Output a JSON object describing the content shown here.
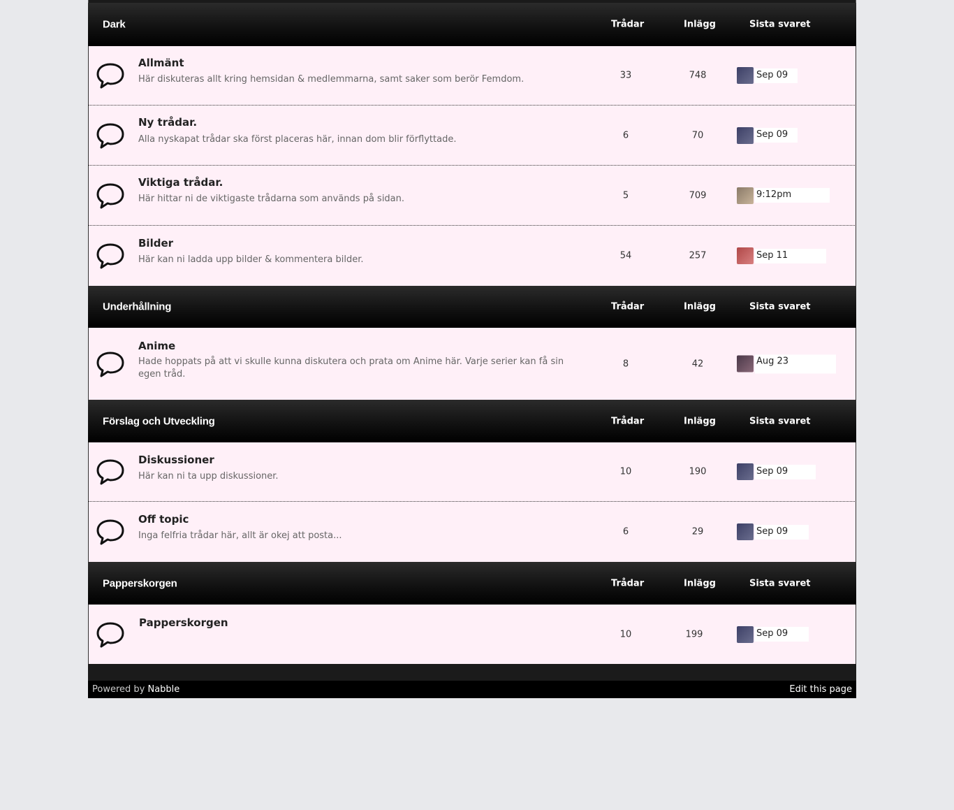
{
  "columns": {
    "threads": "Trådar",
    "posts": "Inlägg",
    "last": "Sista svaret"
  },
  "categories": [
    {
      "title": "Dark",
      "forums": [
        {
          "name": "Allmänt",
          "desc": "Här diskuteras allt kring hemsidan & medlemmarna, samt saker som berör Femdom.",
          "threads": "33",
          "posts": "748",
          "last": "Sep 09"
        },
        {
          "name": "Ny trådar.",
          "desc": "Alla nyskapat trådar ska först placeras här, innan dom blir förflyttade.",
          "threads": "6",
          "posts": "70",
          "last": "Sep 09"
        },
        {
          "name": "Viktiga trådar.",
          "desc": "Här hittar ni de viktigaste trådarna som används på sidan.",
          "threads": "5",
          "posts": "709",
          "last": "9:12pm"
        },
        {
          "name": "Bilder",
          "desc": "Här kan ni ladda upp bilder & kommentera bilder.",
          "threads": "54",
          "posts": "257",
          "last": "Sep 11"
        }
      ]
    },
    {
      "title": "Underhållning",
      "forums": [
        {
          "name": "Anime",
          "desc": "Hade hoppats på att vi skulle kunna diskutera och prata om Anime här. Varje serier kan få sin egen tråd.",
          "threads": "8",
          "posts": "42",
          "last": "Aug 23"
        }
      ]
    },
    {
      "title": "Förslag och Utveckling",
      "forums": [
        {
          "name": "Diskussioner",
          "desc": "Här kan ni ta upp diskussioner.",
          "threads": "10",
          "posts": "190",
          "last": "Sep 09"
        },
        {
          "name": "Off topic",
          "desc": "Inga felfria trådar här, allt är okej att posta...",
          "threads": "6",
          "posts": "29",
          "last": "Sep 09"
        }
      ]
    },
    {
      "title": "Papperskorgen",
      "forums": [
        {
          "name": "Papperskorgen",
          "desc": "",
          "threads": "10",
          "posts": "199",
          "last": "Sep 09"
        }
      ]
    }
  ],
  "footer": {
    "powered_prefix": "Powered by ",
    "powered_link": "Nabble",
    "edit": "Edit this page"
  },
  "colors": {
    "row_bg": "#fff0f8",
    "header_bg": "#121212",
    "page_bg": "#e8e9ec"
  },
  "icons": {
    "forum": "speech-bubble-icon"
  }
}
